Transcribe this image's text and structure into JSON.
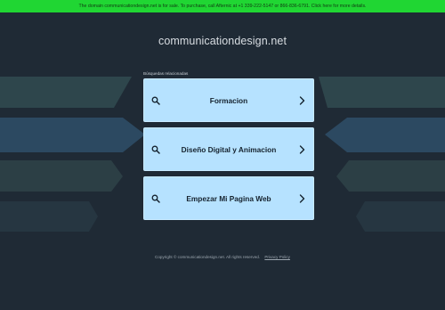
{
  "banner": {
    "text": "The domain communicationdesign.net is for sale. To purchase, call Afternic at +1 339-222-5147 or 866-836-6791. Click here for more details."
  },
  "header": {
    "domain": "communicationdesign.net"
  },
  "related": {
    "heading": "Búsquedas relacionadas",
    "items": [
      {
        "label": "Formacion"
      },
      {
        "label": "Diseño Digital y Animacion"
      },
      {
        "label": "Empezar Mi Pagina Web"
      }
    ]
  },
  "footer": {
    "copyright": "Copyright © communicationdesign.net.  All rights reserved.",
    "privacy_label": "Privacy Policy"
  },
  "colors": {
    "background": "#1f2a35",
    "banner": "#20d633",
    "card": "#b6e2ff",
    "shape_teal": "#2e4a4f",
    "shape_blue": "#2c4a66"
  }
}
